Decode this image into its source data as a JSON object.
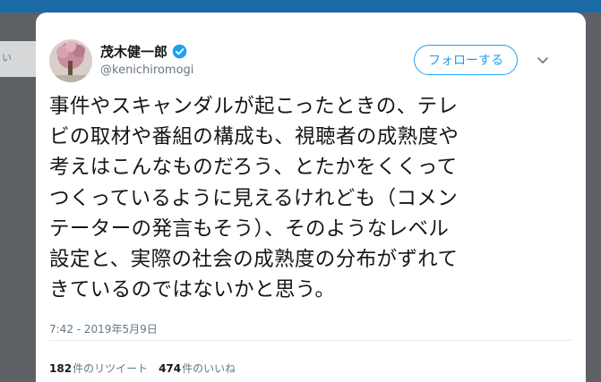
{
  "side": {
    "fragment": "い"
  },
  "user": {
    "name": "茂木健一郎",
    "handle": "@kenichiromogi"
  },
  "follow_button": {
    "label": "フォローする"
  },
  "tweet": {
    "text": "事件やスキャンダルが起こったときの、テレ\nビの取材や番組の構成も、視聴者の成熟度や\n考えはこんなものだろう、とたかをくくって\nつくっているように見えるけれども（コメン\nテーターの発言もそう）、そのようなレベル\n設定と、実際の社会の成熟度の分布がずれて\nきているのではないかと思う。",
    "timestamp": "7:42 - 2019年5月9日"
  },
  "stats": {
    "retweets_count": "182",
    "retweets_label": "件のリツイート",
    "likes_count": "474",
    "likes_label": "件のいいね"
  },
  "icons": {
    "verified": "verified-badge-icon",
    "more": "chevron-down-icon"
  },
  "colors": {
    "accent": "#1da1f2",
    "text": "#14171a",
    "muted": "#657786",
    "backdrop": "#5d6166",
    "topbar": "#1a6aa5"
  }
}
